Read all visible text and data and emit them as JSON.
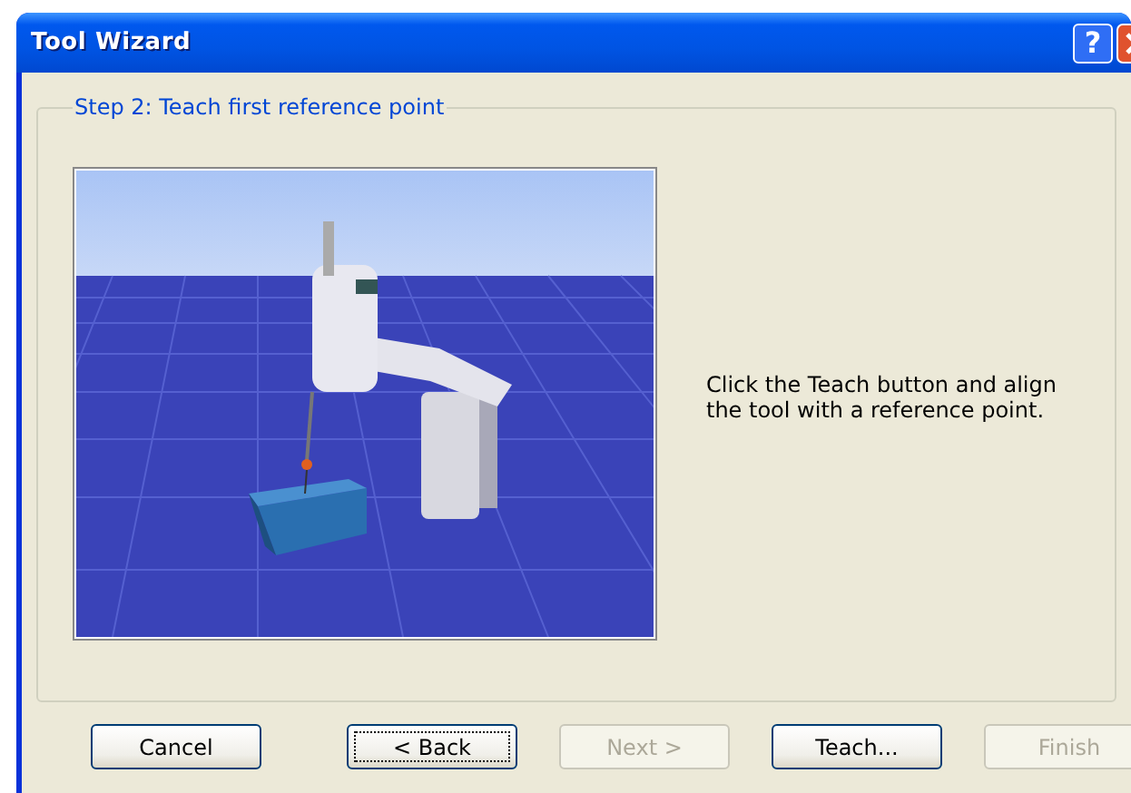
{
  "window": {
    "title": "Tool Wizard",
    "help_button": "?"
  },
  "step": {
    "title": "Step 2: Teach first reference point",
    "instructions": "Click the Teach button and align the tool with a reference point."
  },
  "buttons": [
    {
      "label": "Cancel",
      "disabled": false,
      "focused": false
    },
    {
      "label": "< Back",
      "disabled": false,
      "focused": true
    },
    {
      "label": "Next >",
      "disabled": true,
      "focused": false
    },
    {
      "label": "Teach...",
      "disabled": false,
      "focused": false
    },
    {
      "label": "Finish",
      "disabled": true,
      "focused": false
    }
  ]
}
